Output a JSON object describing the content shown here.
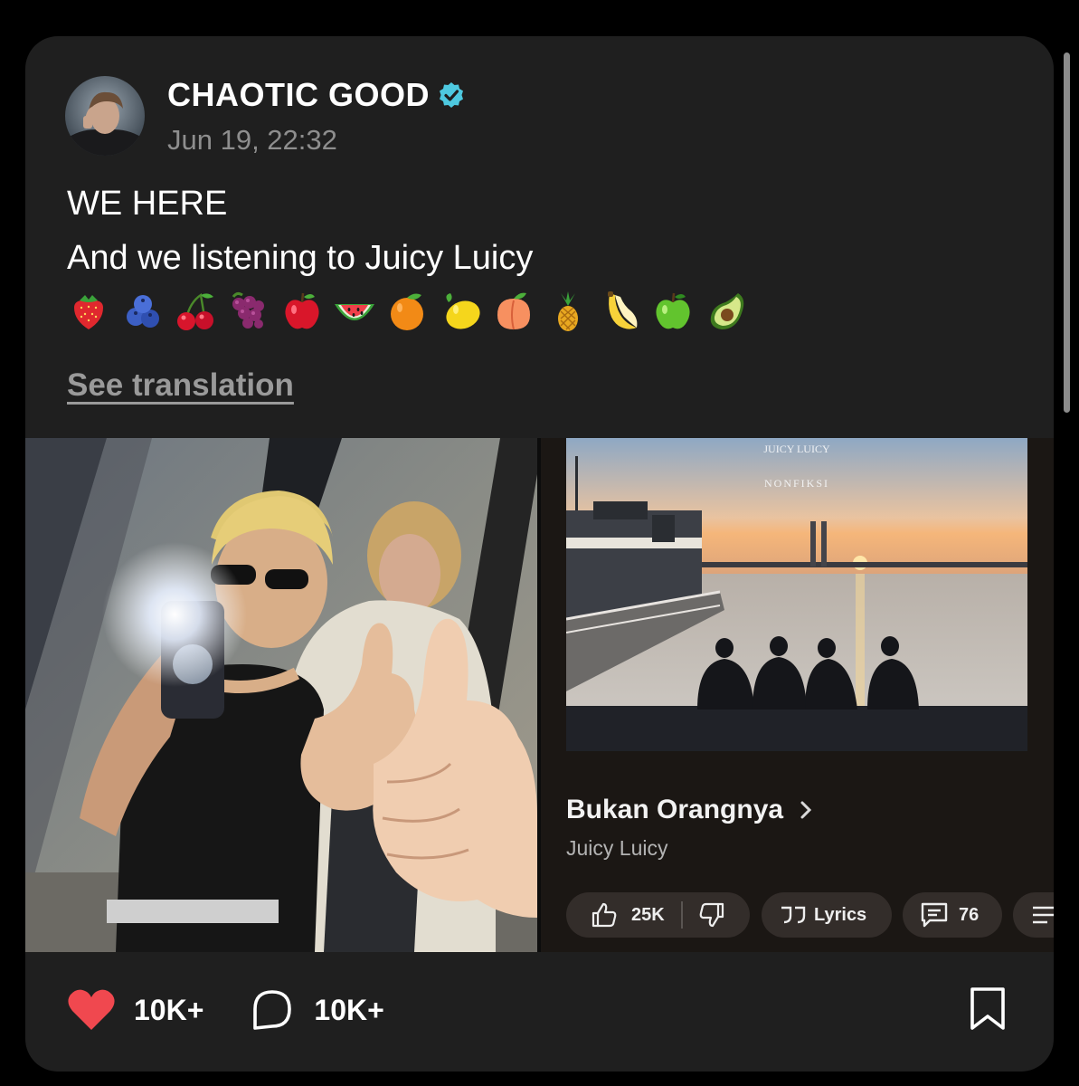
{
  "post": {
    "author_name": "CHAOTIC GOOD",
    "verified": true,
    "timestamp": "Jun 19, 22:32",
    "body_lines": [
      "WE HERE",
      "And we listening to Juicy Luicy"
    ],
    "emojis": [
      "strawberry",
      "blueberries",
      "cherries",
      "grapes",
      "red-apple",
      "watermelon",
      "tangerine",
      "lemon",
      "peach",
      "pineapple",
      "banana",
      "green-apple",
      "avocado"
    ],
    "see_translation": "See translation"
  },
  "music_card": {
    "album_logo": "JUICY LUICY",
    "album_subtitle": "NONFIKSI",
    "song_title": "Bukan Orangnya",
    "artist": "Juicy Luicy",
    "likes": "25K",
    "lyrics_label": "Lyrics",
    "comments": "76"
  },
  "actions": {
    "likes": "10K+",
    "replies": "10K+"
  },
  "colors": {
    "card_bg": "#1f1f1f",
    "verified": "#4ec9e0",
    "like_heart": "#f0484f",
    "muted_text": "#8e8e8e"
  }
}
